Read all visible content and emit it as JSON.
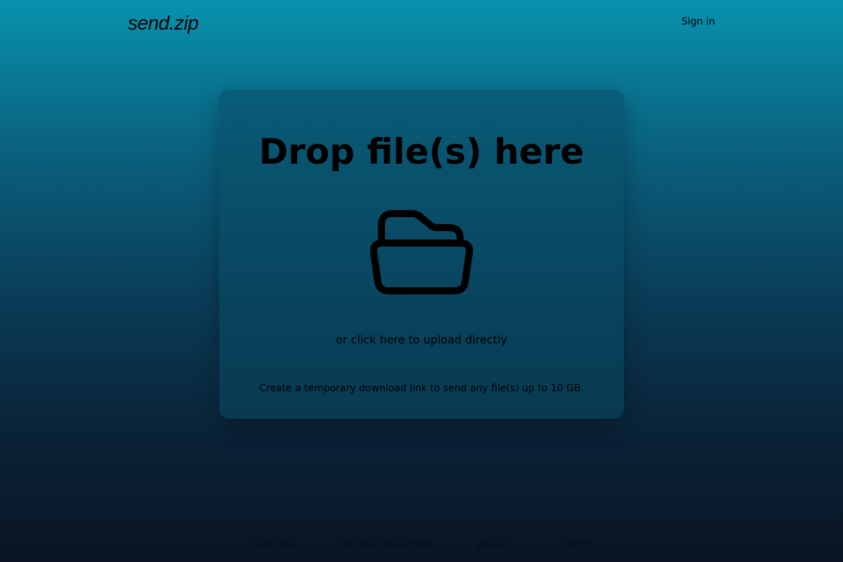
{
  "header": {
    "logo_text": "send.zip",
    "signin_label": "Sign in"
  },
  "dropzone": {
    "title": "Drop file(s) here",
    "icon": "folder-open-icon",
    "upload_link": "or click here to upload directly",
    "description": "Create a temporary download link to send any file(s) up to 10 GB."
  },
  "footer": {
    "links": [
      {
        "label": "jared.ooo"
      },
      {
        "label": "disable animations"
      },
      {
        "label": "privacy"
      },
      {
        "label": "contact"
      }
    ]
  },
  "colors": {
    "background_top": "#0892ae",
    "background_bottom": "#0a1424",
    "text": "#000000"
  }
}
